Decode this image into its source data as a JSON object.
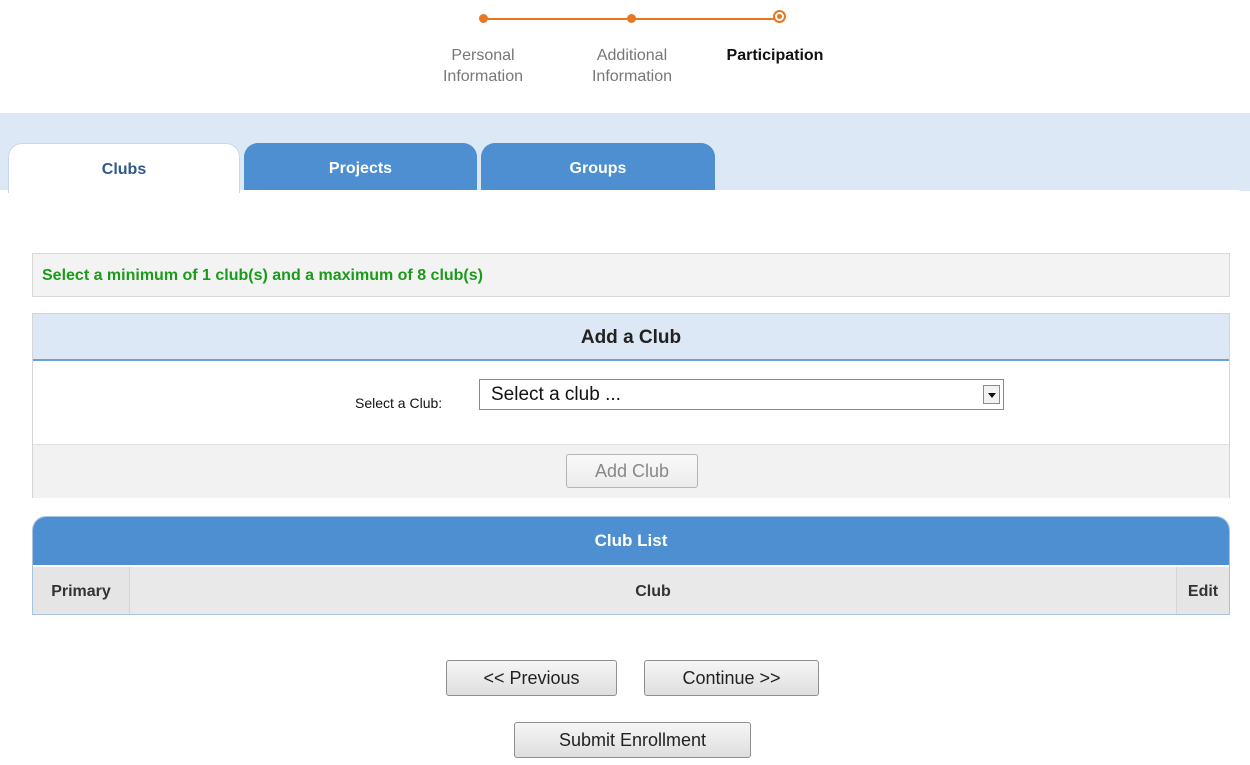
{
  "stepper": {
    "steps": [
      {
        "label": "Personal Information",
        "state": "complete"
      },
      {
        "label": "Additional Information",
        "state": "complete"
      },
      {
        "label": "Participation",
        "state": "current"
      }
    ],
    "accent_color": "#e87722"
  },
  "tabs": [
    {
      "label": "Clubs",
      "active": true
    },
    {
      "label": "Projects",
      "active": false
    },
    {
      "label": "Groups",
      "active": false
    }
  ],
  "info_message": "Select a minimum of 1 club(s) and a maximum of 8 club(s)",
  "add_club": {
    "title": "Add a Club",
    "select_label": "Select a Club:",
    "select_value": "Select a club ...",
    "add_button": "Add Club"
  },
  "club_list": {
    "title": "Club List",
    "columns": [
      "Primary",
      "Club",
      "Edit"
    ]
  },
  "nav": {
    "previous": "<< Previous",
    "continue": "Continue >>",
    "submit": "Submit Enrollment"
  },
  "colors": {
    "tab_blue": "#4d8fd0",
    "band_light_blue": "#dce8f5",
    "message_green": "#1a9b1a"
  }
}
